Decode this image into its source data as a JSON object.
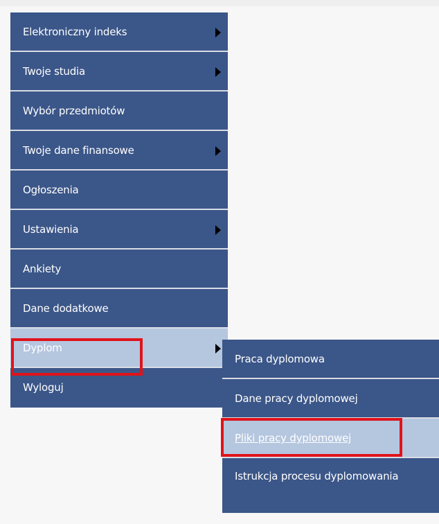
{
  "menu": {
    "items": [
      {
        "label": "Elektroniczny indeks"
      },
      {
        "label": "Twoje studia"
      },
      {
        "label": "Wybór przedmiotów"
      },
      {
        "label": "Twoje dane finansowe"
      },
      {
        "label": "Ogłoszenia"
      },
      {
        "label": "Ustawienia"
      },
      {
        "label": "Ankiety"
      },
      {
        "label": "Dane dodatkowe"
      },
      {
        "label": "Dyplom"
      },
      {
        "label": "Wyloguj"
      }
    ]
  },
  "submenu": {
    "items": [
      {
        "label": "Praca dyplomowa"
      },
      {
        "label": "Dane pracy dyplomowej"
      },
      {
        "label": "Pliki pracy dyplomowej"
      },
      {
        "label": "Istrukcja procesu dyplomowania"
      }
    ]
  },
  "colors": {
    "menu_bg": "#3b5688",
    "active_bg": "#b5c6df",
    "highlight": "#e0131a"
  },
  "icons": {
    "submenu_arrow": "triangle-right-icon"
  }
}
